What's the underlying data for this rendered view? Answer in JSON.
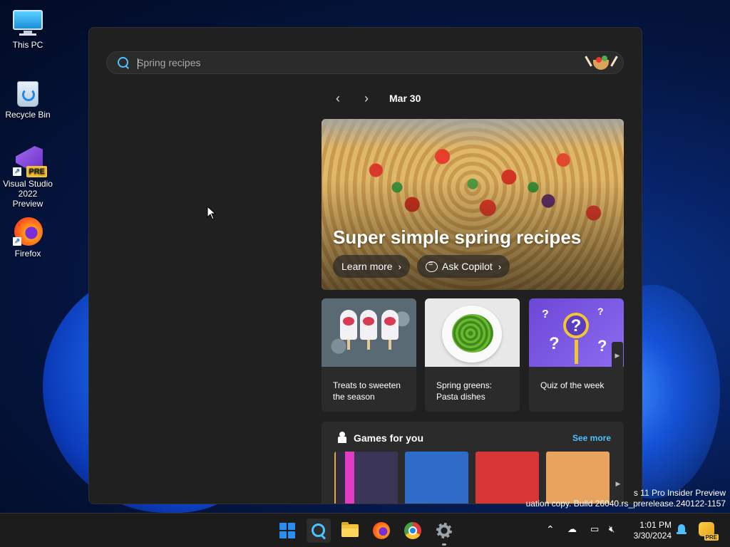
{
  "desktop": {
    "icons": [
      {
        "label": "This PC"
      },
      {
        "label": "Recycle Bin"
      },
      {
        "label": "Visual Studio 2022 Preview",
        "badge": "PRE"
      },
      {
        "label": "Firefox"
      }
    ]
  },
  "search": {
    "placeholder": "Spring recipes",
    "value": ""
  },
  "date_nav": {
    "prev_label": "‹",
    "next_label": "›",
    "date": "Mar 30"
  },
  "hero": {
    "title": "Super simple spring recipes",
    "learn_more": "Learn more",
    "ask_copilot": "Ask Copilot"
  },
  "cards": [
    {
      "title": "Treats to sweeten the season"
    },
    {
      "title": "Spring greens: Pasta dishes"
    },
    {
      "title": "Quiz of the week"
    }
  ],
  "games": {
    "title": "Games for you",
    "see_more": "See more",
    "tiles": [
      "game-1",
      "game-2",
      "game-3",
      "game-4"
    ]
  },
  "watermark": {
    "line1": "s 11 Pro Insider Preview",
    "line2": "uation copy. Build 26040.rs_prerelease.240122-1157"
  },
  "taskbar": {
    "apps": [
      "start-icon",
      "search-icon",
      "file-explorer-icon",
      "firefox-icon",
      "chrome-icon",
      "settings-icon"
    ],
    "clock_time": "1:01 PM",
    "clock_date": "3/30/2024"
  },
  "colors": {
    "accent": "#4cc2ff",
    "panel_bg": "#202020",
    "card_bg": "#2b2b2b"
  }
}
